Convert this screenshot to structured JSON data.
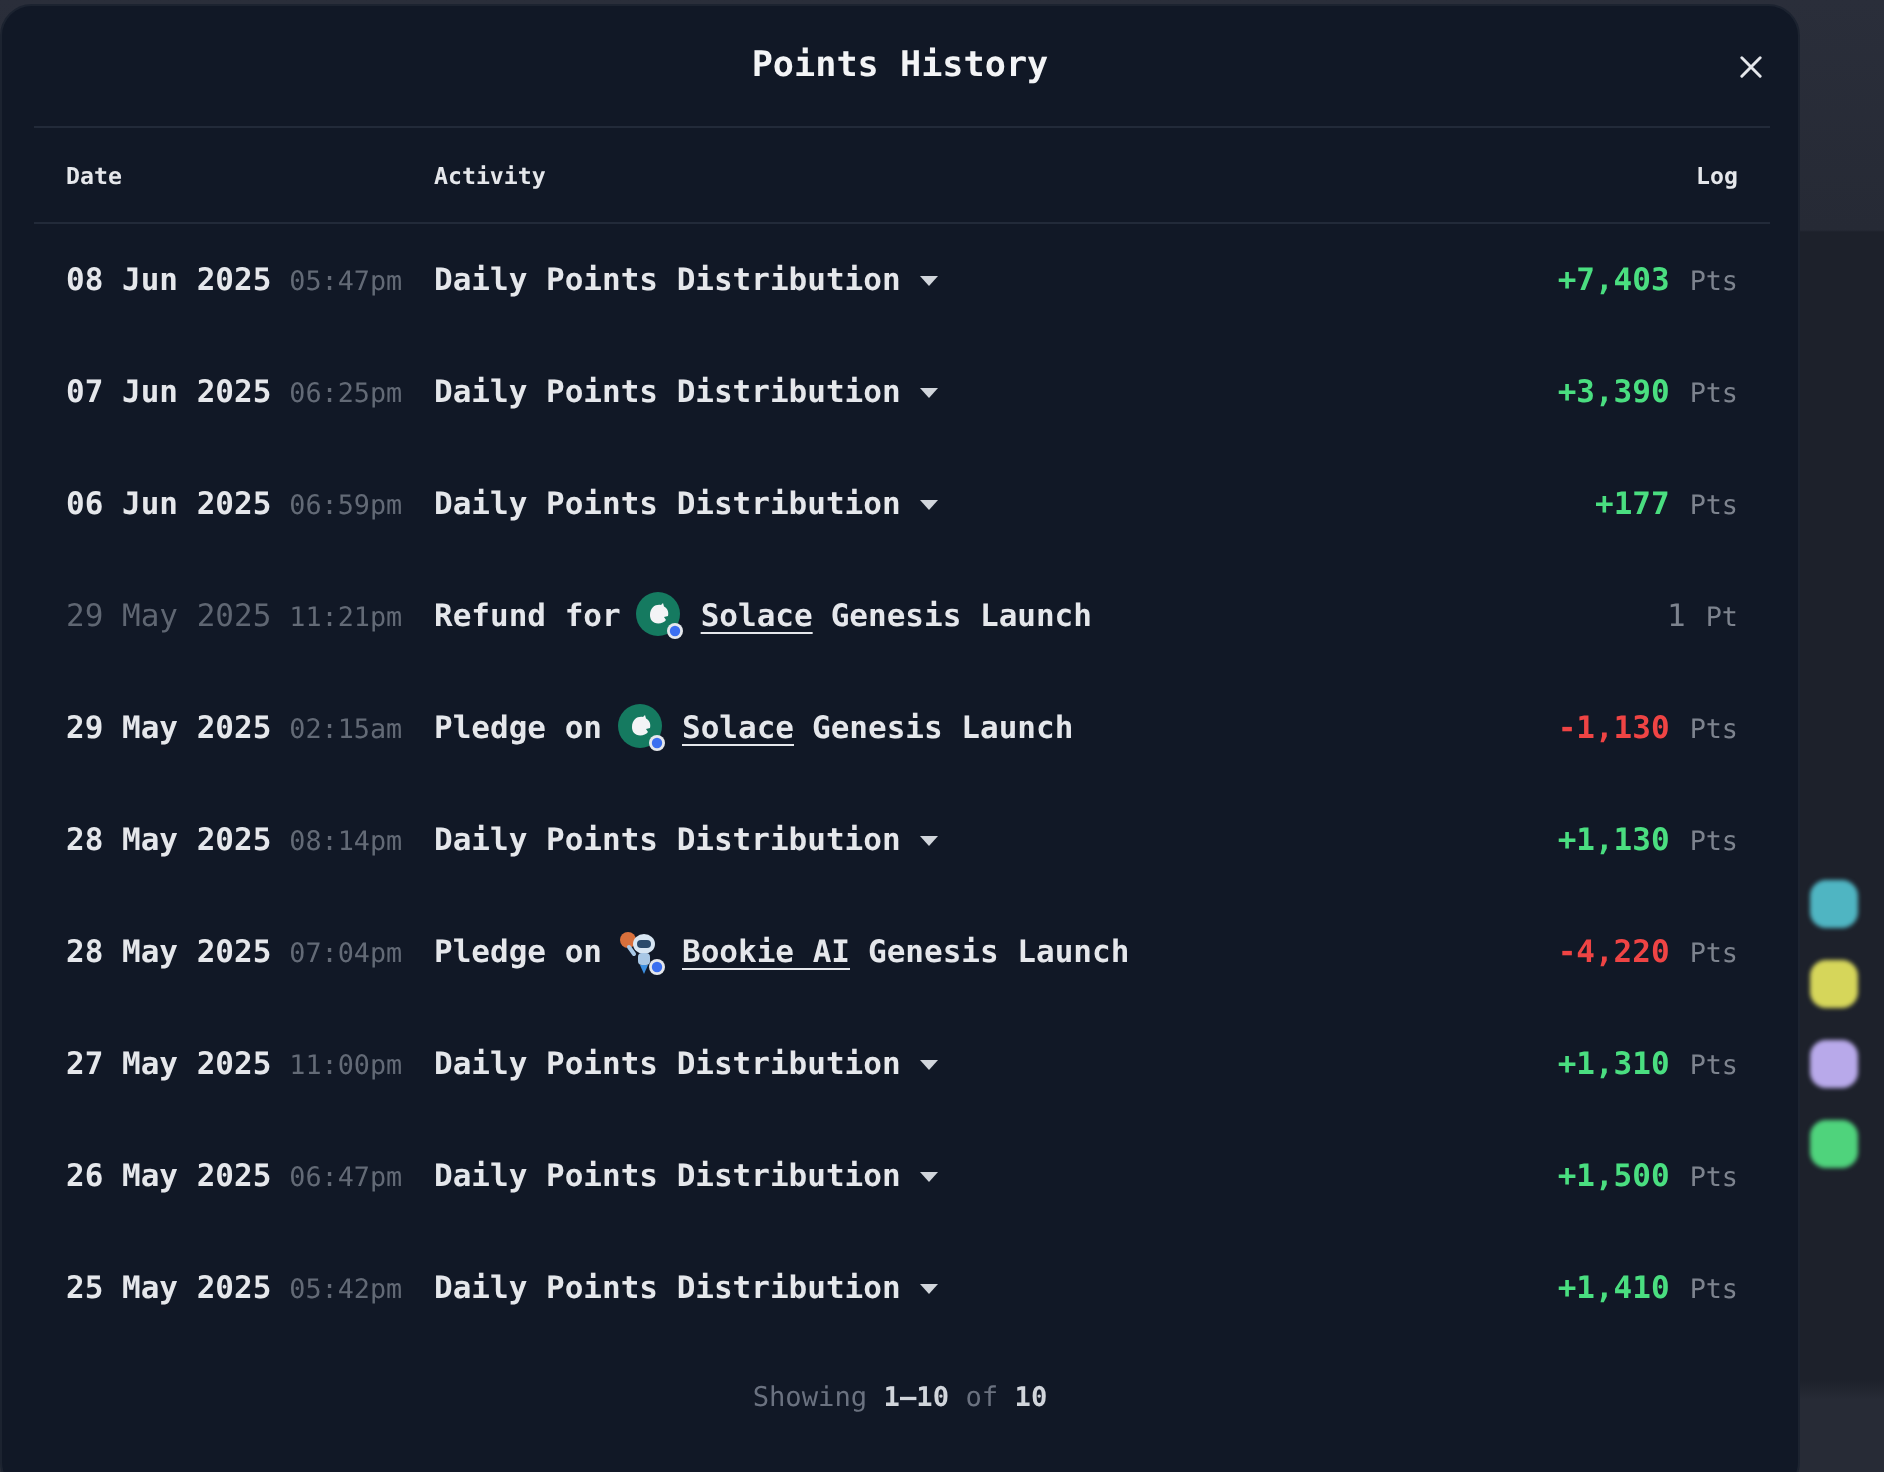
{
  "dialog": {
    "title": "Points History"
  },
  "table": {
    "columns": [
      "Date",
      "Activity",
      "Log"
    ],
    "rows": [
      {
        "date": "08 Jun 2025",
        "time": "05:47pm",
        "dimmed": false,
        "activity": {
          "kind": "dropdown",
          "label": "Daily Points Distribution"
        },
        "log": {
          "amount": "+7,403",
          "unit": "Pts",
          "color": "#4ade80"
        }
      },
      {
        "date": "07 Jun 2025",
        "time": "06:25pm",
        "dimmed": false,
        "activity": {
          "kind": "dropdown",
          "label": "Daily Points Distribution"
        },
        "log": {
          "amount": "+3,390",
          "unit": "Pts",
          "color": "#4ade80"
        }
      },
      {
        "date": "06 Jun 2025",
        "time": "06:59pm",
        "dimmed": false,
        "activity": {
          "kind": "dropdown",
          "label": "Daily Points Distribution"
        },
        "log": {
          "amount": "+177",
          "unit": "Pts",
          "color": "#4ade80"
        }
      },
      {
        "date": "29 May 2025",
        "time": "11:21pm",
        "dimmed": true,
        "activity": {
          "kind": "launch",
          "prefix": "Refund for",
          "token": {
            "name": "Solace",
            "kind": "disc"
          },
          "suffix": "Genesis Launch"
        },
        "log": {
          "amount": "1",
          "unit": "Pt",
          "color": "#7d838e"
        }
      },
      {
        "date": "29 May 2025",
        "time": "02:15am",
        "dimmed": false,
        "activity": {
          "kind": "launch",
          "prefix": "Pledge on",
          "token": {
            "name": "Solace",
            "kind": "disc"
          },
          "suffix": "Genesis Launch"
        },
        "log": {
          "amount": "-1,130",
          "unit": "Pts",
          "color": "#ef4444"
        }
      },
      {
        "date": "28 May 2025",
        "time": "08:14pm",
        "dimmed": false,
        "activity": {
          "kind": "dropdown",
          "label": "Daily Points Distribution"
        },
        "log": {
          "amount": "+1,130",
          "unit": "Pts",
          "color": "#4ade80"
        }
      },
      {
        "date": "28 May 2025",
        "time": "07:04pm",
        "dimmed": false,
        "activity": {
          "kind": "launch",
          "prefix": "Pledge on",
          "token": {
            "name": "Bookie AI",
            "kind": "robot"
          },
          "suffix": "Genesis Launch"
        },
        "log": {
          "amount": "-4,220",
          "unit": "Pts",
          "color": "#ef4444"
        }
      },
      {
        "date": "27 May 2025",
        "time": "11:00pm",
        "dimmed": false,
        "activity": {
          "kind": "dropdown",
          "label": "Daily Points Distribution"
        },
        "log": {
          "amount": "+1,310",
          "unit": "Pts",
          "color": "#4ade80"
        }
      },
      {
        "date": "26 May 2025",
        "time": "06:47pm",
        "dimmed": false,
        "activity": {
          "kind": "dropdown",
          "label": "Daily Points Distribution"
        },
        "log": {
          "amount": "+1,500",
          "unit": "Pts",
          "color": "#4ade80"
        }
      },
      {
        "date": "25 May 2025",
        "time": "05:42pm",
        "dimmed": false,
        "activity": {
          "kind": "dropdown",
          "label": "Daily Points Distribution"
        },
        "log": {
          "amount": "+1,410",
          "unit": "Pts",
          "color": "#4ade80"
        }
      }
    ]
  },
  "footer": {
    "summary": "Showing **1–10** of **10**"
  },
  "backdrop": {
    "tiles": [
      {
        "color": "#4fb5c2"
      },
      {
        "color": "#d6d65a"
      },
      {
        "color": "#b8a9ea"
      },
      {
        "color": "#4fd37c"
      }
    ]
  }
}
